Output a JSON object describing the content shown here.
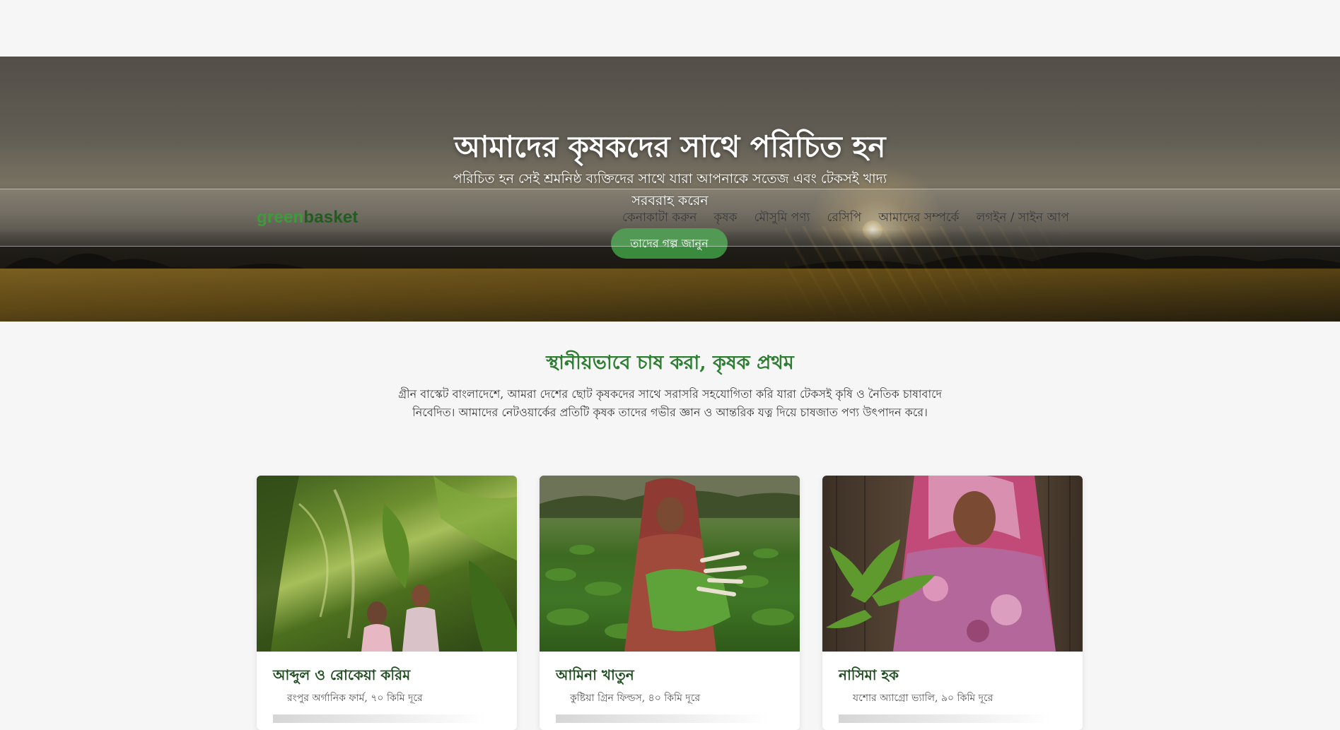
{
  "hero": {
    "title": "আমাদের কৃষকদের সাথে পরিচিত হন",
    "subtitle": "পরিচিত হন সেই শ্রমনিষ্ঠ ব্যক্তিদের সাথে যারা আপনাকে সতেজ এবং টেকসই খাদ্য সরবরাহ করেন",
    "cta_label": "তাদের গল্প জানুন"
  },
  "navbar": {
    "logo_part1": "green",
    "logo_part2": "basket",
    "links": [
      "কেনাকাটা করুন",
      "কৃষক",
      "মৌসুমি পণ্য",
      "রেসিপি",
      "আমাদের সম্পর্কে",
      "লগইন / সাইন আপ"
    ]
  },
  "intro": {
    "title": "স্থানীয়ভাবে চাষ করা, কৃষক প্রথম",
    "text": "গ্রীন বাস্কেট বাংলাদেশে, আমরা দেশের ছোট কৃষকদের সাথে সরাসরি সহযোগিতা করি যারা টেকসই কৃষি ও নৈতিক চাষাবাদে নিবেদিত। আমাদের নেটওয়ার্কের প্রতিটি কৃষক তাদের গভীর জ্ঞান ও আন্তরিক যত্ন দিয়ে চাষজাত পণ্য উৎপাদন করে।"
  },
  "farmers": [
    {
      "name": "আব্দুল ও রোকেয়া করিম",
      "farm": "রংপুর অর্গানিক ফার্ম, ৭০ কিমি দূরে"
    },
    {
      "name": "আমিনা খাতুন",
      "farm": "কুষ্টিয়া গ্রিন ফিল্ডস, ৪০ কিমি দূরে"
    },
    {
      "name": "নাসিমা হক",
      "farm": "যশোর অ্যাগ্রো ভ্যালি, ৯০ কিমি দূরে"
    }
  ],
  "colors": {
    "brand_green": "#3a8b3d",
    "brand_dark_green": "#1f5e1f",
    "heading_green": "#2e7d32",
    "page_background": "#f6f6f6"
  }
}
